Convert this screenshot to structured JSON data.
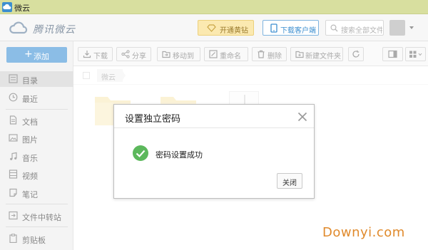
{
  "window": {
    "title": "微云",
    "app_icon": "cloud-icon"
  },
  "header": {
    "brand": "腾讯微云",
    "vip_button": "开通黄钻",
    "client_button": "下载客户端",
    "search_placeholder": "搜索全部文件"
  },
  "sidebar": {
    "add_button": "添加",
    "items": [
      {
        "label": "目录",
        "icon": "list-icon"
      },
      {
        "label": "最近",
        "icon": "clock-icon"
      },
      {
        "label": "文档",
        "icon": "document-icon"
      },
      {
        "label": "图片",
        "icon": "image-icon"
      },
      {
        "label": "音乐",
        "icon": "music-icon"
      },
      {
        "label": "视频",
        "icon": "video-icon"
      },
      {
        "label": "笔记",
        "icon": "note-icon"
      },
      {
        "label": "文件中转站",
        "icon": "transfer-icon"
      },
      {
        "label": "剪贴板",
        "icon": "clipboard-icon"
      }
    ]
  },
  "toolbar": {
    "download": "下载",
    "share": "分享",
    "move": "移动到",
    "rename": "重命名",
    "delete": "删除",
    "new_folder": "新建文件夹"
  },
  "breadcrumb": {
    "root": "微云"
  },
  "dialog": {
    "title": "设置独立密码",
    "message": "密码设置成功",
    "close_button": "关闭"
  },
  "watermark": "Downyi.com",
  "colors": {
    "titlebar": "#d8df9f",
    "add_button": "#8bbde6",
    "success": "#5cb85c",
    "watermark": "#e08a2c"
  }
}
